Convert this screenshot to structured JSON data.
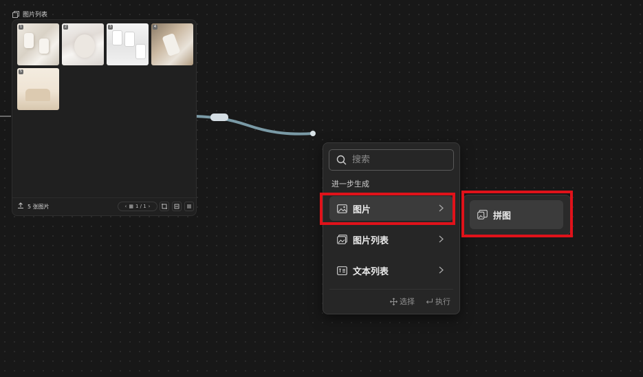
{
  "node": {
    "title": "图片列表",
    "thumbs": [
      "1",
      "2",
      "3",
      "4",
      "5"
    ],
    "count_label": "5 张图片",
    "pager_label": "1 / 1"
  },
  "menu": {
    "search_placeholder": "搜索",
    "section_label": "进一步生成",
    "items": [
      {
        "label": "图片",
        "icon": "image-icon"
      },
      {
        "label": "图片列表",
        "icon": "image-list-icon"
      },
      {
        "label": "文本列表",
        "icon": "text-list-icon"
      }
    ],
    "hint_select": "选择",
    "hint_execute": "执行"
  },
  "submenu": {
    "items": [
      {
        "label": "拼图",
        "icon": "collage-icon"
      }
    ]
  },
  "colors": {
    "background": "#181818",
    "highlight_border": "#e0121a",
    "connector": "#8fb3c2"
  }
}
